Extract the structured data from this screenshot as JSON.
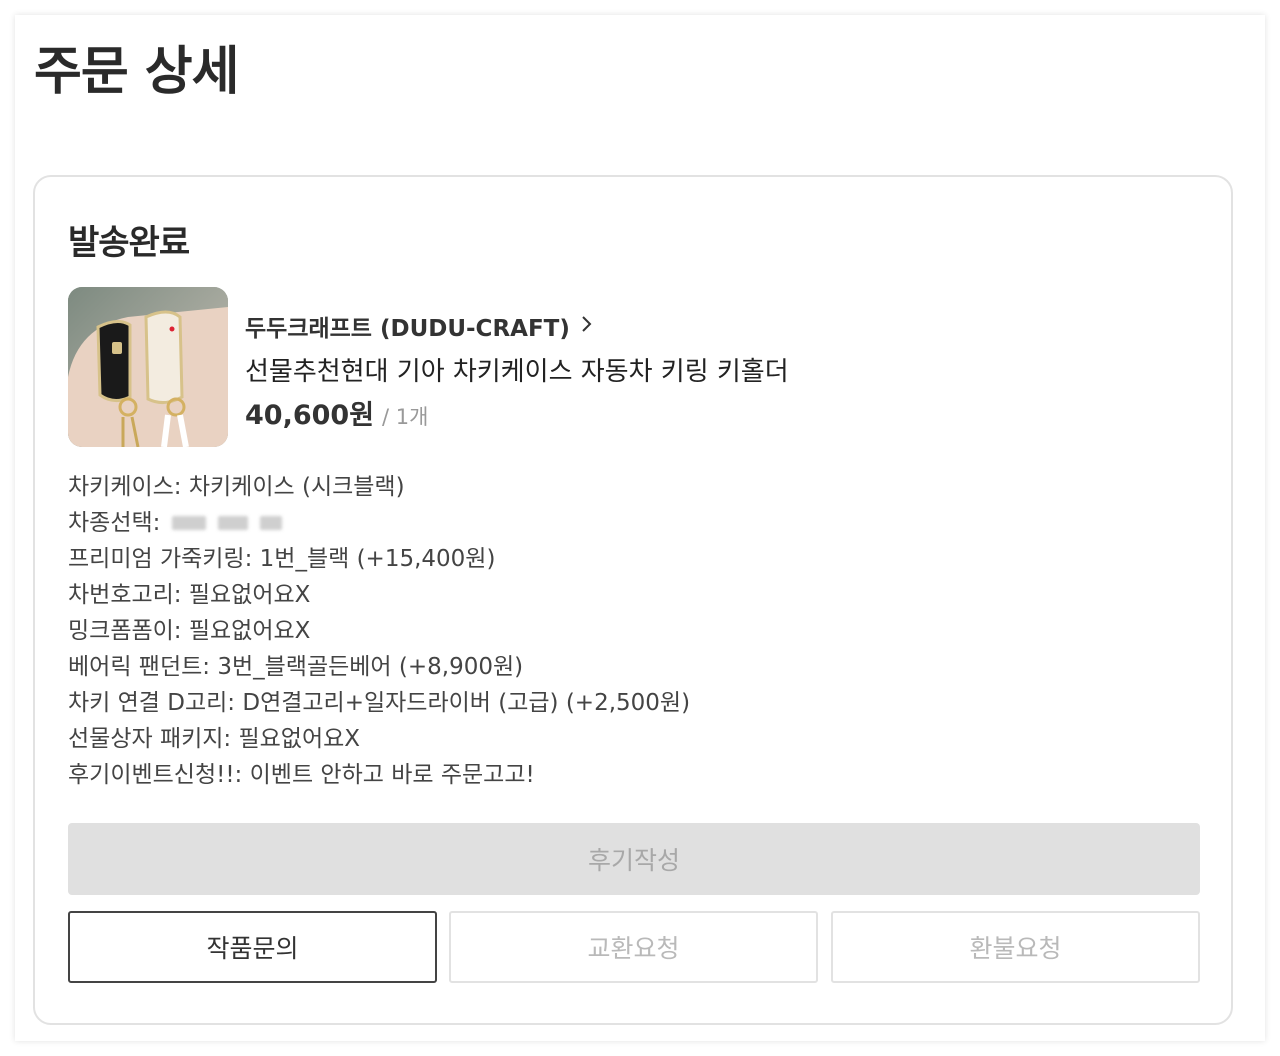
{
  "page": {
    "title": "주문 상세"
  },
  "order": {
    "status": "발송완료",
    "seller": "두두크래프트 (DUDU-CRAFT)",
    "product_name": "선물추천현대 기아 차키케이스 자동차 키링 키홀더",
    "price": "40,600원",
    "quantity": "/ 1개",
    "options": [
      "차키케이스: 차키케이스 (시크블랙)",
      "차종선택:",
      "프리미엄 가죽키링: 1번_블랙 (+15,400원)",
      "차번호고리: 필요없어요X",
      "밍크폼폼이: 필요없어요X",
      "베어릭 팬던트: 3번_블랙골든베어 (+8,900원)",
      "차키 연결 D고리: D연결고리+일자드라이버 (고급) (+2,500원)",
      "선물상자 패키지: 필요없어요X",
      "후기이벤트신청!!: 이벤트 안하고 바로 주문고고!"
    ]
  },
  "actions": {
    "review": "후기작성",
    "inquiry": "작품문의",
    "exchange": "교환요청",
    "refund": "환불요청"
  },
  "icons": {
    "seller_link": "chevron-right-icon"
  },
  "colors": {
    "title": "#2a2a2a",
    "disabled_bg": "#e0e0e0",
    "disabled_text": "#a8a8a8",
    "border": "#e2e2e2"
  }
}
